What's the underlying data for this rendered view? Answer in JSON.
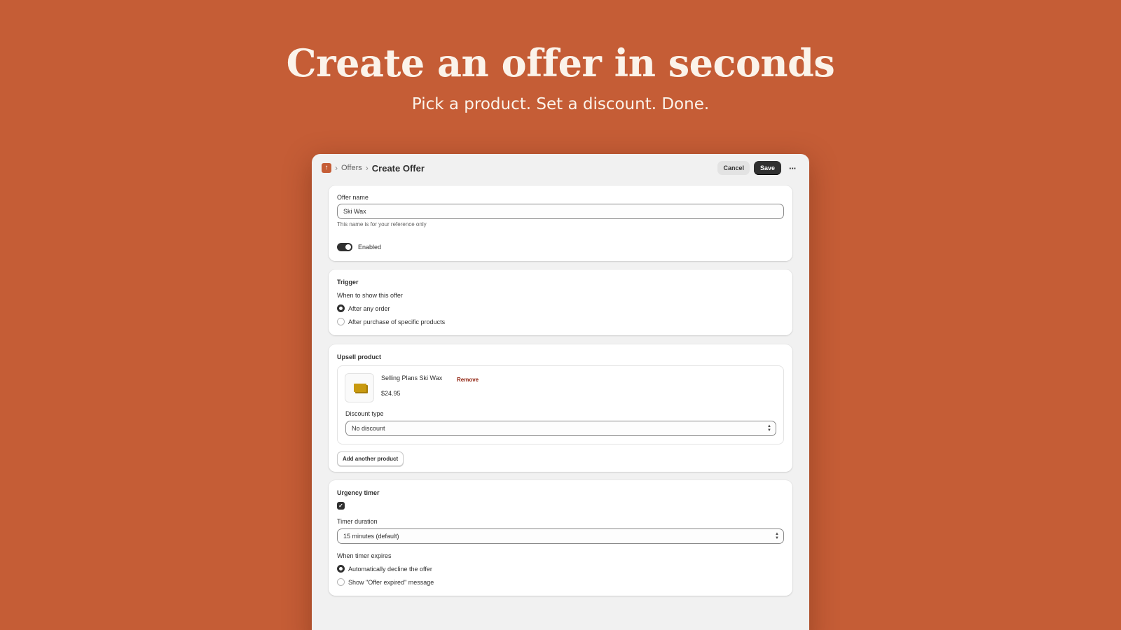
{
  "hero": {
    "title": "Create an offer in seconds",
    "subtitle": "Pick a product. Set a discount. Done."
  },
  "colors": {
    "background": "#c55d36",
    "primary_button": "#303030",
    "remove_link": "#8e1f0b"
  },
  "topbar": {
    "logo_icon": "upload-arrow-icon",
    "breadcrumb_parent": "Offers",
    "breadcrumb_separator": "›",
    "page_title": "Create Offer",
    "cancel_label": "Cancel",
    "save_label": "Save",
    "more_icon": "ellipsis-icon",
    "more_glyph": "···"
  },
  "offer_card": {
    "name_label": "Offer name",
    "name_value": "Ski Wax",
    "name_help": "This name is for your reference only",
    "enabled_label": "Enabled",
    "enabled": true
  },
  "trigger_card": {
    "heading": "Trigger",
    "question": "When to show this offer",
    "options": [
      {
        "label": "After any order",
        "selected": true
      },
      {
        "label": "After purchase of specific products",
        "selected": false
      }
    ]
  },
  "upsell_card": {
    "heading": "Upsell product",
    "product_name": "Selling Plans Ski Wax",
    "product_price": "$24.95",
    "remove_label": "Remove",
    "discount_label": "Discount type",
    "discount_value": "No discount",
    "add_button_label": "Add another product"
  },
  "urgency_card": {
    "heading": "Urgency timer",
    "timer_enabled": true,
    "duration_label": "Timer duration",
    "duration_value": "15 minutes (default)",
    "expires_label": "When timer expires",
    "expire_options": [
      {
        "label": "Automatically decline the offer",
        "selected": true
      },
      {
        "label": "Show \"Offer expired\" message",
        "selected": false
      }
    ]
  }
}
